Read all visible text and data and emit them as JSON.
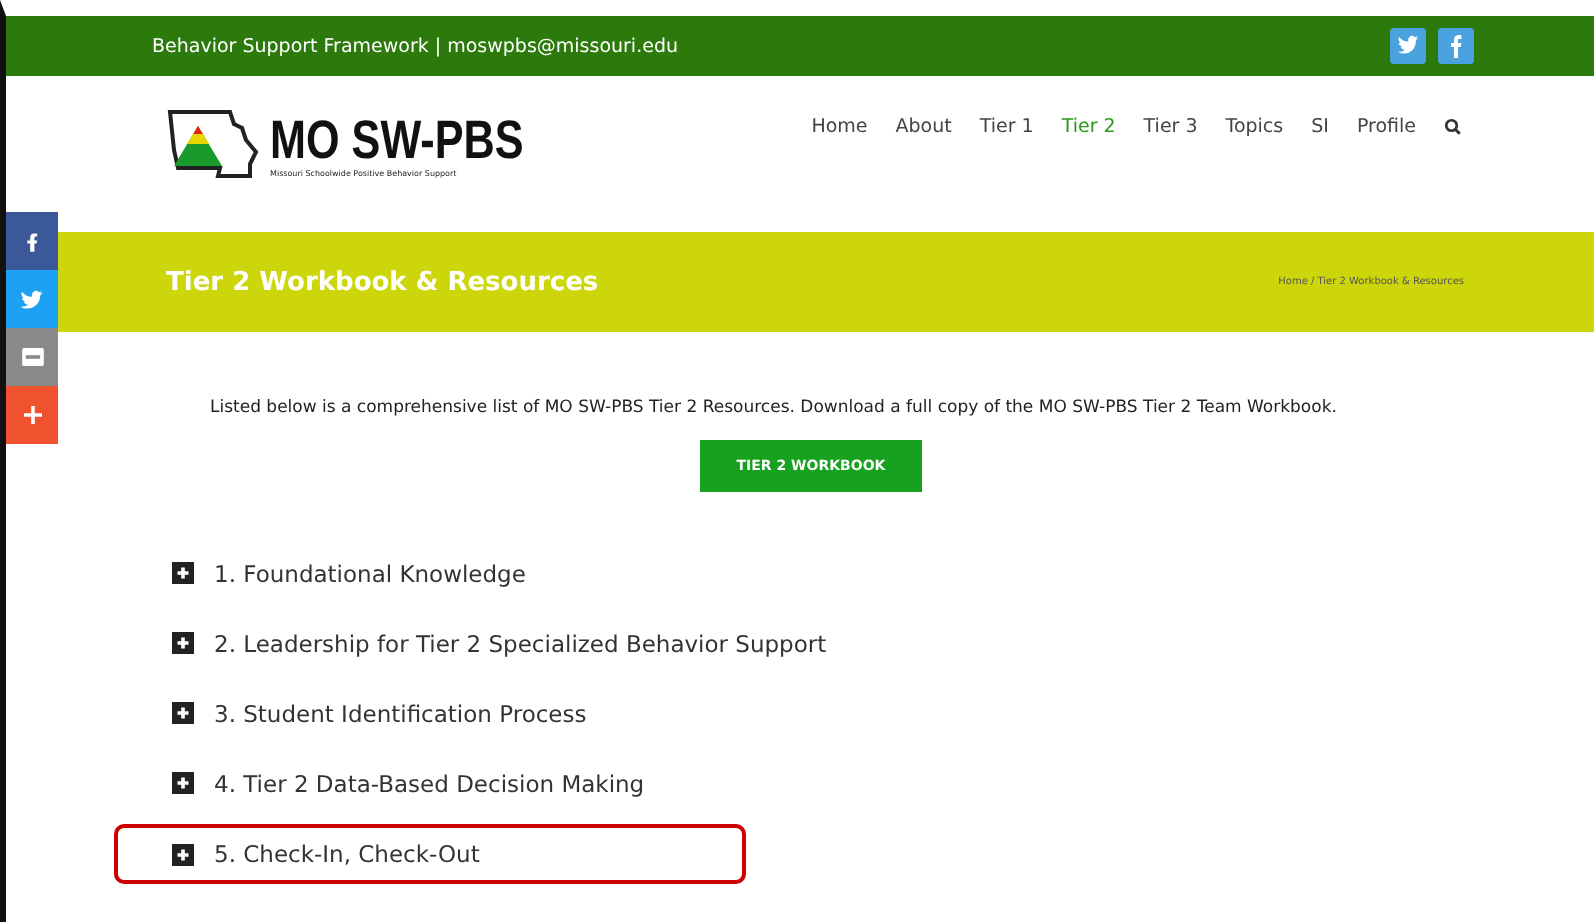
{
  "top_bar": {
    "text": "Behavior Support Framework | moswpbs@missouri.edu"
  },
  "logo": {
    "title": "MO SW-PBS",
    "subtitle": "Missouri Schoolwide Positive Behavior Support"
  },
  "nav": [
    {
      "label": "Home",
      "selected": false
    },
    {
      "label": "About",
      "selected": false
    },
    {
      "label": "Tier 1",
      "selected": false
    },
    {
      "label": "Tier 2",
      "selected": true
    },
    {
      "label": "Tier 3",
      "selected": false
    },
    {
      "label": "Topics",
      "selected": false
    },
    {
      "label": "SI",
      "selected": false
    },
    {
      "label": "Profile",
      "selected": false
    }
  ],
  "social_sidebar": [
    {
      "kind": "facebook"
    },
    {
      "kind": "twitter"
    },
    {
      "kind": "email"
    },
    {
      "kind": "more"
    }
  ],
  "banner": {
    "title": "Tier 2 Workbook & Resources",
    "breadcrumb": "Home / Tier 2 Workbook & Resources"
  },
  "intro": "Listed below is a comprehensive list of MO SW-PBS Tier 2 Resources. Download a full copy of the MO SW-PBS Tier 2 Team Workbook.",
  "workbook_button": "TIER 2 WORKBOOK",
  "sections": [
    {
      "label": "1. Foundational Knowledge",
      "highlighted": false
    },
    {
      "label": "2. Leadership for Tier 2 Specialized Behavior Support",
      "highlighted": false
    },
    {
      "label": "3. Student Identification Process",
      "highlighted": false
    },
    {
      "label": "4. Tier 2 Data-Based Decision Making",
      "highlighted": false
    },
    {
      "label": "5. Check-In, Check-Out",
      "highlighted": true
    }
  ]
}
